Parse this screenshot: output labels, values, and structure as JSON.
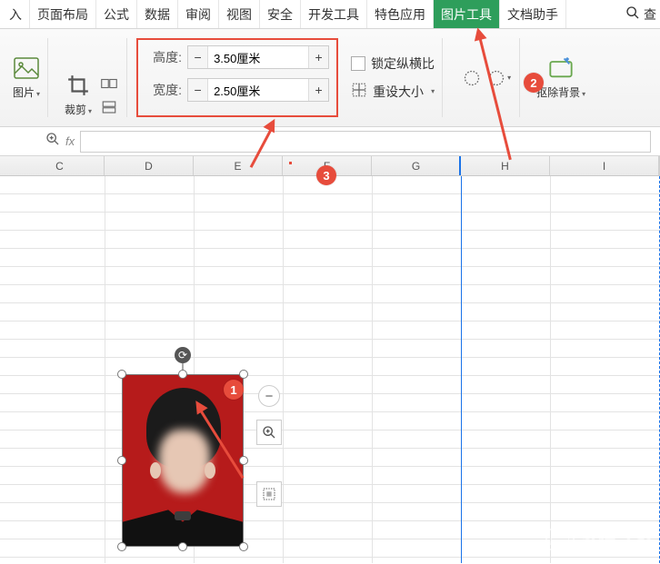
{
  "tabs": {
    "t0": "入",
    "t1": "页面布局",
    "t2": "公式",
    "t3": "数据",
    "t4": "审阅",
    "t5": "视图",
    "t6": "安全",
    "t7": "开发工具",
    "t8": "特色应用",
    "t9": "图片工具",
    "t10": "文档助手",
    "search": "查"
  },
  "ribbon": {
    "pic_label": "图片",
    "crop_label": "裁剪",
    "height_label": "高度:",
    "width_label": "宽度:",
    "height_value": "3.50厘米",
    "width_value": "2.50厘米",
    "lock_label": "锁定纵横比",
    "reset_label": "重设大小",
    "removebg_label": "抠除背景"
  },
  "columns": [
    "C",
    "D",
    "E",
    "F",
    "G",
    "H",
    "I"
  ],
  "badges": {
    "b1": "1",
    "b2": "2",
    "b3": "3"
  },
  "watermark": "系统之家",
  "chart_data": null
}
